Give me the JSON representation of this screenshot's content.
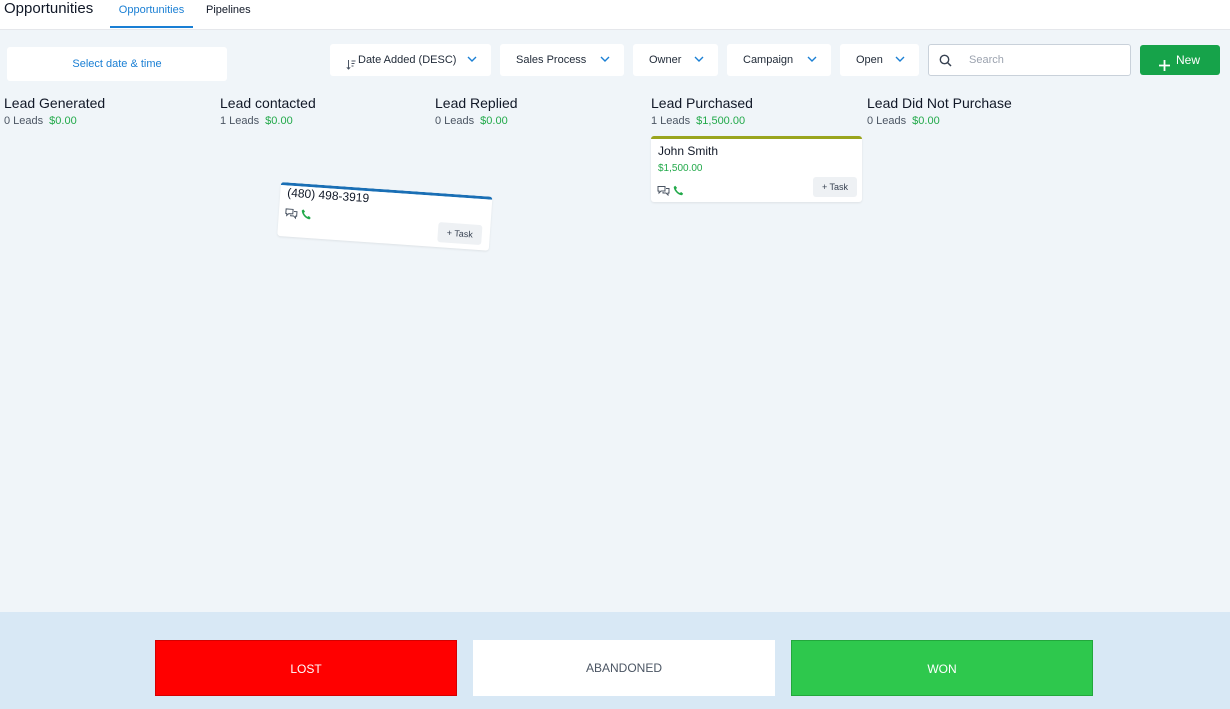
{
  "header": {
    "title": "Opportunities",
    "tabs": [
      {
        "label": "Opportunities",
        "active": true
      },
      {
        "label": "Pipelines",
        "active": false
      }
    ]
  },
  "toolbar": {
    "date_picker": "Select date & time",
    "sort": {
      "icon": "sort-icon",
      "label": "Date Added (DESC)"
    },
    "filters": [
      {
        "label": "Sales Process"
      },
      {
        "label": "Owner"
      },
      {
        "label": "Campaign"
      },
      {
        "label": "Open"
      }
    ],
    "search": {
      "placeholder": "Search",
      "value": ""
    },
    "new_label": "New",
    "accent": "#1a7fd4",
    "new_color": "#16a34a"
  },
  "stages": [
    {
      "title": "Lead Generated",
      "count": "0 Leads",
      "amount": "$0.00"
    },
    {
      "title": "Lead contacted",
      "count": "1 Leads",
      "amount": "$0.00"
    },
    {
      "title": "Lead Replied",
      "count": "0 Leads",
      "amount": "$0.00"
    },
    {
      "title": "Lead Purchased",
      "count": "1 Leads",
      "amount": "$1,500.00"
    },
    {
      "title": "Lead Did Not Purchase",
      "count": "0 Leads",
      "amount": "$0.00"
    }
  ],
  "cards": [
    {
      "stage": "Lead contacted",
      "title": "(480) 498-3919",
      "amount": "",
      "task_label": "+ Task",
      "being_dragged": true,
      "accent": "#1a6fb5",
      "icons": [
        "chat-icon",
        "phone-icon"
      ]
    },
    {
      "stage": "Lead Purchased",
      "title": "John Smith",
      "amount": "$1,500.00",
      "task_label": "+ Task",
      "being_dragged": false,
      "accent": "#9aa51e",
      "icons": [
        "chat-icon",
        "phone-icon"
      ]
    }
  ],
  "drop_zones": [
    {
      "label": "LOST",
      "color": "#ff0000"
    },
    {
      "label": "ABANDONED",
      "color": "#ffffff"
    },
    {
      "label": "WON",
      "color": "#2ec84d"
    }
  ]
}
